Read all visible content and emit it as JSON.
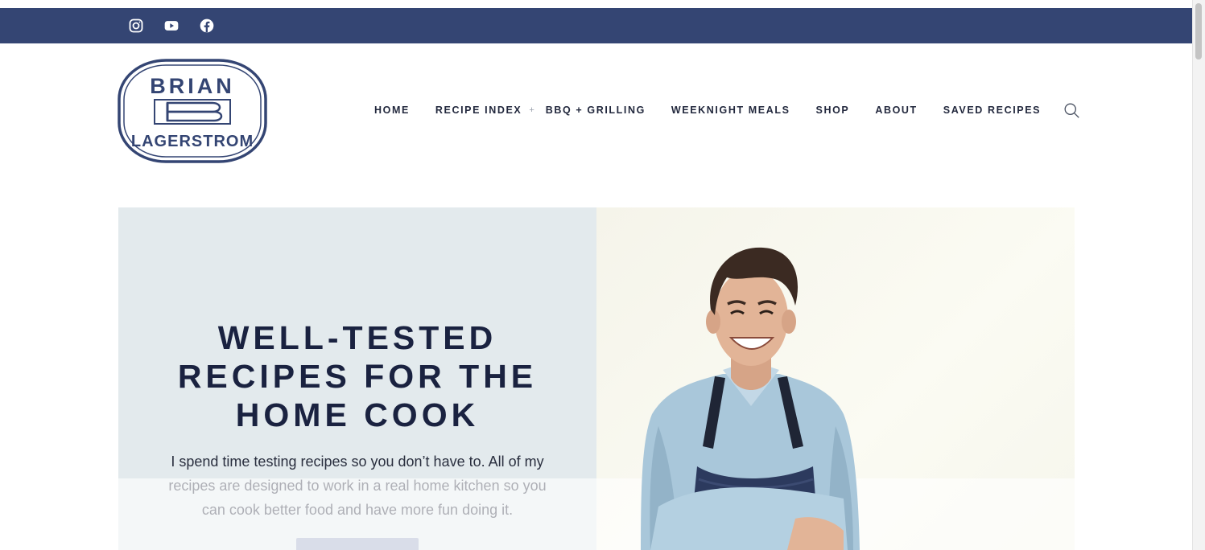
{
  "social": {
    "icons": [
      "instagram-icon",
      "youtube-icon",
      "facebook-icon"
    ],
    "bar_color": "#344573"
  },
  "logo": {
    "line1": "BRIAN",
    "line2": "LAGERSTROM",
    "color": "#344573"
  },
  "nav": {
    "home": "HOME",
    "recipe_index": "RECIPE INDEX",
    "recipe_index_plus": "+",
    "bbq": "BBQ + GRILLING",
    "weeknight": "WEEKNIGHT MEALS",
    "shop": "SHOP",
    "about": "ABOUT",
    "saved": "SAVED RECIPES",
    "search_icon": "search-icon"
  },
  "hero": {
    "title_line1": "WELL-TESTED",
    "title_line2": "RECIPES FOR THE",
    "title_line3": "HOME COOK",
    "text": "I spend time testing recipes so you don’t have to. All of my recipes are designed to work in a real home kitchen so you can cook better food and have more fun doing it.",
    "left_bg": "#e3eaed",
    "title_color": "#1a2240",
    "cta_color": "#9ca6c6"
  }
}
